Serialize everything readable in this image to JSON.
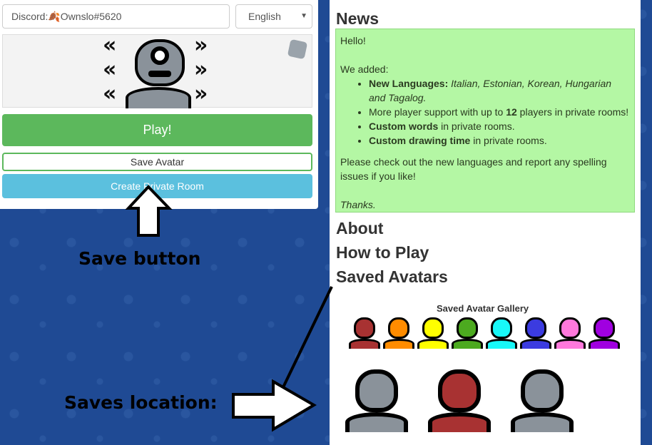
{
  "login": {
    "name_value": "Discord:🍂Ownslo#5620",
    "language": "English"
  },
  "buttons": {
    "play": "Play!",
    "save_avatar": "Save Avatar",
    "create_private_room": "Create Private Room"
  },
  "news": {
    "title": "News",
    "greeting": "Hello!",
    "intro": "We added:",
    "items": [
      {
        "bold": "New Languages:",
        "text": " Italian, Estonian, Korean, Hungarian and Tagalog."
      },
      {
        "pre": "More player support with up to ",
        "bold": "12",
        "text": " players in private rooms!"
      },
      {
        "bold": "Custom words",
        "text": " in private rooms."
      },
      {
        "bold": "Custom drawing time",
        "text": " in private rooms."
      }
    ],
    "outro": "Please check out the new languages and report any spelling issues if you like!",
    "thanks": "Thanks."
  },
  "sections": {
    "about": "About",
    "how_to_play": "How to Play",
    "saved_avatars": "Saved Avatars"
  },
  "gallery": {
    "title": "Saved Avatar Gallery",
    "colors": [
      "#a83232",
      "#ff8c00",
      "#ffff00",
      "#4caa1f",
      "#18f8f8",
      "#3b3be0",
      "#ff78dc",
      "#a000e0"
    ],
    "saved_colors": [
      "#8a929a",
      "#a83232",
      "#8a929a"
    ]
  },
  "annotations": {
    "save_button": "Save button",
    "saves_location": "Saves location:"
  }
}
